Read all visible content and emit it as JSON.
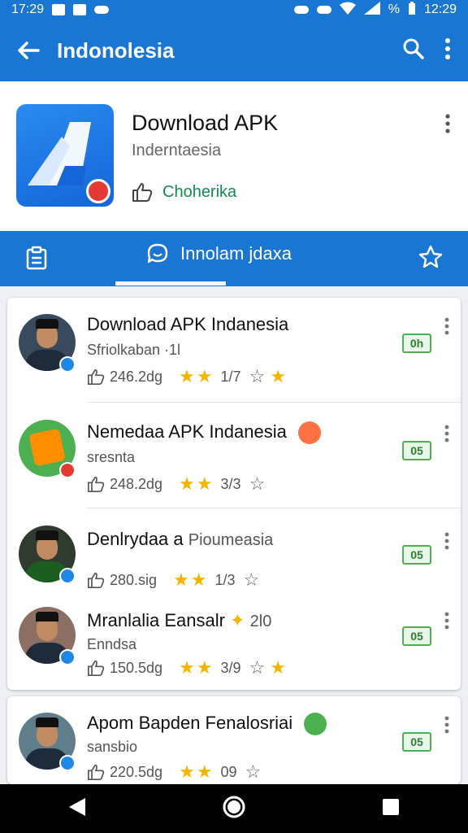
{
  "status_bar": {
    "time_left": "17:29",
    "battery": "%",
    "time_right": "12:29"
  },
  "app_bar": {
    "title": "Indonolesia"
  },
  "app": {
    "name": "Download APK",
    "subtitle": "Inderntaesia",
    "like_label": "Choherika"
  },
  "tabs": {
    "active_label": "Innolam jdaxa"
  },
  "items": [
    {
      "title": "Download APK Indanesia",
      "subtitle": "Sfriolkaban ·1l",
      "likes": "246.2dg",
      "reviews": "1/7",
      "badge": "0h"
    },
    {
      "title": "Nemedaa APK Indanesia",
      "subtitle": "sresnta",
      "likes": "248.2dg",
      "reviews": "3/3",
      "badge": "05"
    },
    {
      "title": "Denlrydaa a",
      "title_extra": "Pioumeasia",
      "subtitle": "",
      "likes": "280.sig",
      "reviews": "1/3",
      "badge": "05"
    },
    {
      "title": "Mranlalia Eansalr",
      "title_extra": "2l0",
      "subtitle": "Enndsa",
      "likes": "150.5dg",
      "reviews": "3/9",
      "badge": "05"
    },
    {
      "title": "Apom Bapden Fenalosriai",
      "subtitle": "sansbio",
      "likes": "220.5dg",
      "reviews": "09",
      "badge": "05"
    }
  ],
  "colors": {
    "primary": "#1976d2",
    "badge_green": "#4caf50",
    "star": "#f4b400"
  }
}
